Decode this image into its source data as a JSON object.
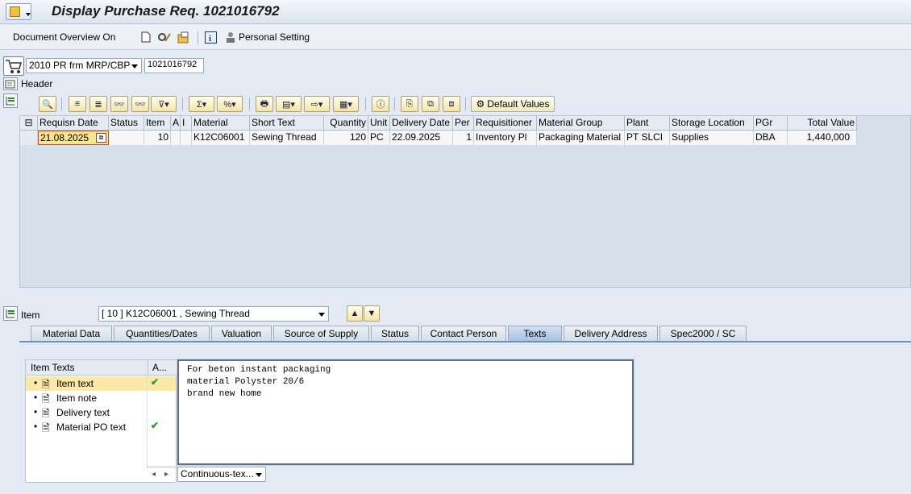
{
  "window": {
    "title": "Display Purchase Req. 1021016792"
  },
  "appbar": {
    "document_overview": "Document Overview On",
    "personal_setting": "Personal Setting"
  },
  "doc": {
    "type": "2010 PR frm MRP/CBP",
    "number": "1021016792",
    "header_label": "Header"
  },
  "grid": {
    "default_values": "Default Values",
    "columns": [
      "Requisn Date",
      "Status",
      "Item",
      "A",
      "I",
      "Material",
      "Short Text",
      "Quantity",
      "Unit",
      "Delivery Date",
      "Per",
      "Requisitioner",
      "Material Group",
      "Plant",
      "Storage Location",
      "PGr",
      "Total Value"
    ],
    "row": [
      "21.08.2025",
      "",
      "10",
      "",
      "",
      "K12C06001",
      "Sewing Thread",
      "120",
      "PC",
      "22.09.2025",
      "1",
      "Inventory Pl",
      "Packaging Material",
      "PT SLCI",
      "Supplies",
      "DBA",
      "1,440,000"
    ]
  },
  "item": {
    "label": "Item",
    "selector": "[ 10 ] K12C06001 , Sewing Thread"
  },
  "tabs": [
    "Material Data",
    "Quantities/Dates",
    "Valuation",
    "Source of Supply",
    "Status",
    "Contact Person",
    "Texts",
    "Delivery Address",
    "Spec2000 / SC"
  ],
  "texts": {
    "tree_header": "Item Texts",
    "col_a": "A...",
    "items": [
      {
        "label": "Item text",
        "check": "✔"
      },
      {
        "label": "Item note",
        "check": ""
      },
      {
        "label": "Delivery text",
        "check": ""
      },
      {
        "label": "Material PO text",
        "check": "✔"
      }
    ],
    "content": "For beton instant packaging\nmaterial Polyster 20/6\nbrand new home",
    "format": "Continuous-tex..."
  }
}
